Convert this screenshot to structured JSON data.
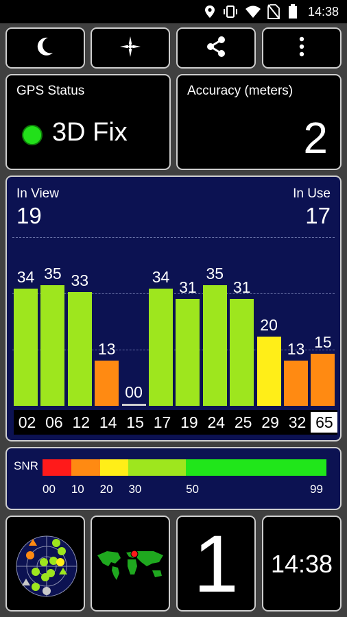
{
  "status_bar": {
    "time": "14:38",
    "icons": [
      "location-pin-icon",
      "vibrate-icon",
      "wifi-icon",
      "no-sim-icon",
      "battery-icon"
    ]
  },
  "toolbar": {
    "buttons": [
      {
        "icon": "moon-icon",
        "label": "night mode"
      },
      {
        "icon": "compass-star-icon",
        "label": "compass"
      },
      {
        "icon": "share-icon",
        "label": "share"
      },
      {
        "icon": "more-vert-icon",
        "label": "more options"
      }
    ]
  },
  "gps_status": {
    "label": "GPS Status",
    "value": "3D Fix",
    "indicator_color": "#22e01a"
  },
  "accuracy": {
    "label": "Accuracy (meters)",
    "value": "2"
  },
  "satellites": {
    "in_view_label": "In View",
    "in_view": "19",
    "in_use_label": "In Use",
    "in_use": "17"
  },
  "chart_data": {
    "type": "bar",
    "categories": [
      "02",
      "06",
      "12",
      "14",
      "15",
      "17",
      "19",
      "24",
      "25",
      "29",
      "32",
      "65"
    ],
    "values": [
      34,
      35,
      33,
      13,
      0,
      34,
      31,
      35,
      31,
      20,
      13,
      15
    ],
    "value_labels": [
      "34",
      "35",
      "33",
      "13",
      "00",
      "34",
      "31",
      "35",
      "31",
      "20",
      "13",
      "15"
    ],
    "highlighted_category": "65",
    "ylim": [
      0,
      50
    ],
    "grid": true,
    "color_scale": [
      {
        "min": 0,
        "max": 10,
        "color": "#ff1a1a"
      },
      {
        "min": 10,
        "max": 20,
        "color": "#ff8a12"
      },
      {
        "min": 20,
        "max": 30,
        "color": "#ffee18"
      },
      {
        "min": 30,
        "max": 50,
        "color": "#9ee61e"
      },
      {
        "min": 50,
        "max": 99,
        "color": "#20e61a"
      }
    ]
  },
  "snr_legend": {
    "label": "SNR",
    "ticks": [
      "00",
      "10",
      "20",
      "30",
      "50",
      "99"
    ]
  },
  "bottom_tiles": {
    "radar_icon": "sky-radar-icon",
    "map_icon": "world-map-icon",
    "count": "1",
    "clock": "14:38"
  }
}
